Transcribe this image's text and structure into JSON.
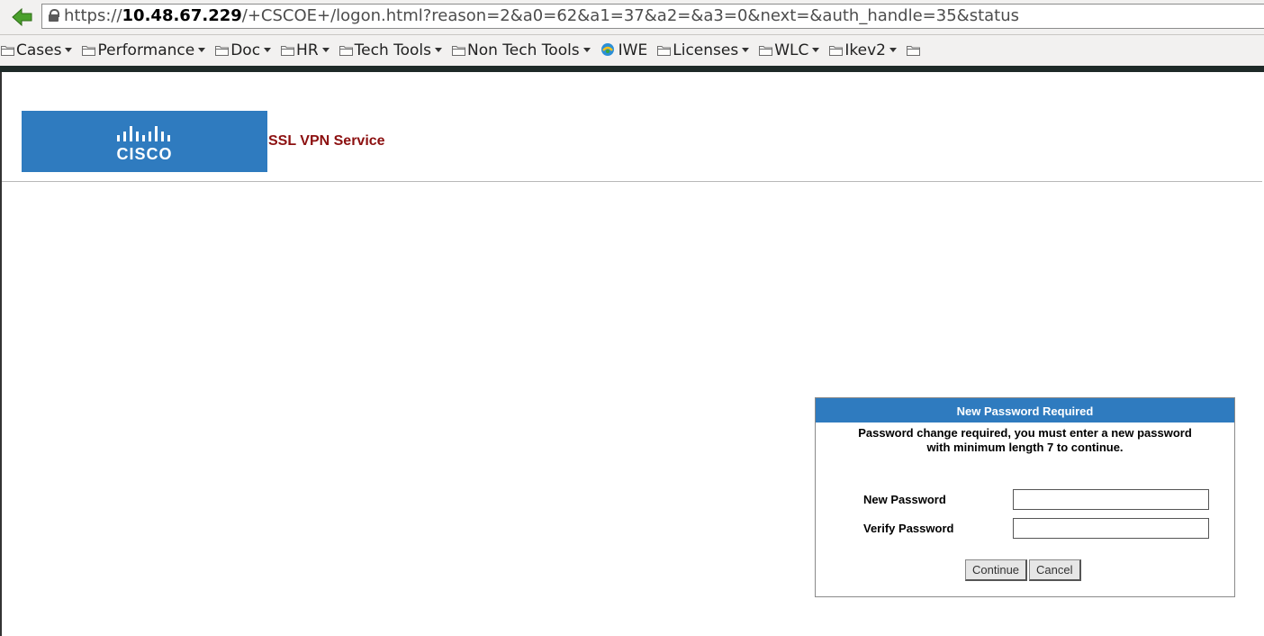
{
  "browser": {
    "url_prefix": "https://",
    "url_host": "10.48.67.229",
    "url_path": "/+CSCOE+/logon.html?reason=2&a0=62&a1=37&a2=&a3=0&next=&auth_handle=35&status"
  },
  "bookmarks": [
    {
      "label": "Cases",
      "icon": "folder-icon",
      "dropdown": true
    },
    {
      "label": "Performance",
      "icon": "folder-icon",
      "dropdown": true
    },
    {
      "label": "Doc",
      "icon": "folder-icon",
      "dropdown": true
    },
    {
      "label": "HR",
      "icon": "folder-icon",
      "dropdown": true
    },
    {
      "label": "Tech Tools",
      "icon": "folder-icon",
      "dropdown": true
    },
    {
      "label": "Non Tech Tools",
      "icon": "folder-icon",
      "dropdown": true
    },
    {
      "label": "IWE",
      "icon": "iwe-icon",
      "dropdown": false
    },
    {
      "label": "Licenses",
      "icon": "folder-icon",
      "dropdown": true
    },
    {
      "label": "WLC",
      "icon": "folder-icon",
      "dropdown": true
    },
    {
      "label": "Ikev2",
      "icon": "folder-icon",
      "dropdown": true
    },
    {
      "label": "",
      "icon": "folder-icon",
      "dropdown": false
    }
  ],
  "page": {
    "logo_text": "CISCO",
    "service_title": "SSL VPN Service"
  },
  "dialog": {
    "title": "New Password Required",
    "message_line1": "Password change required, you must enter a new password",
    "message_line2": "with minimum length 7 to continue.",
    "new_password_label": "New Password",
    "new_password_value": "",
    "verify_password_label": "Verify Password",
    "verify_password_value": "",
    "continue_label": "Continue",
    "cancel_label": "Cancel"
  },
  "colors": {
    "cisco_blue": "#2f7bbf",
    "title_red": "#8c1010",
    "chrome_bg": "#f2f1f0",
    "dark_strip": "#1e2a28"
  }
}
